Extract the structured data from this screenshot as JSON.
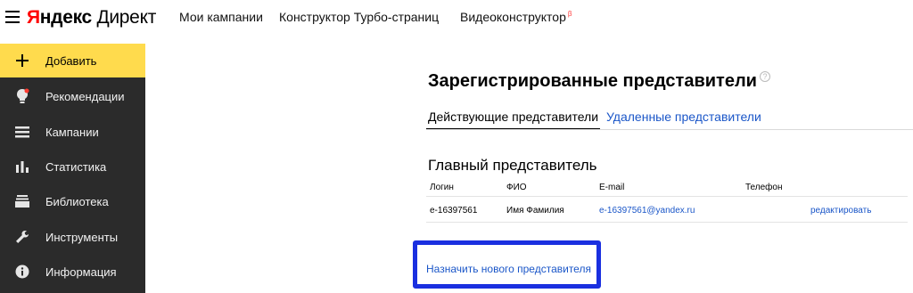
{
  "header": {
    "logo": {
      "first_letter": "Я",
      "brand_rest": "ндекс",
      "product": "Директ"
    },
    "nav": [
      {
        "label": "Мои кампании"
      },
      {
        "label": "Конструктор Турбо-страниц"
      },
      {
        "label": "Видеоконструктор",
        "badge": "β"
      }
    ]
  },
  "sidebar": {
    "items": [
      {
        "label": "Добавить",
        "icon": "plus-icon",
        "highlight": "#ffdb4d"
      },
      {
        "label": "Рекомендации",
        "icon": "lightbulb-icon"
      },
      {
        "label": "Кампании",
        "icon": "list-icon"
      },
      {
        "label": "Статистика",
        "icon": "bar-chart-icon"
      },
      {
        "label": "Библиотека",
        "icon": "library-icon"
      },
      {
        "label": "Инструменты",
        "icon": "wrench-icon"
      },
      {
        "label": "Информация",
        "icon": "info-icon"
      }
    ]
  },
  "main": {
    "title": "Зарегистрированные представители",
    "help_icon": "?",
    "tabs": [
      {
        "label": "Действующие представители",
        "active": true
      },
      {
        "label": "Удаленные представители",
        "active": false
      }
    ],
    "section_title": "Главный представитель",
    "table": {
      "headers": [
        "Логин",
        "ФИО",
        "E-mail",
        "Телефон"
      ],
      "rows": [
        {
          "login": "e-16397561",
          "name": "Имя Фамилия",
          "email": "e-16397561@yandex.ru",
          "phone": "",
          "action": "редактировать"
        }
      ]
    },
    "assign_link": "Назначить нового представителя",
    "highlight_color": "#1a2fe0"
  }
}
